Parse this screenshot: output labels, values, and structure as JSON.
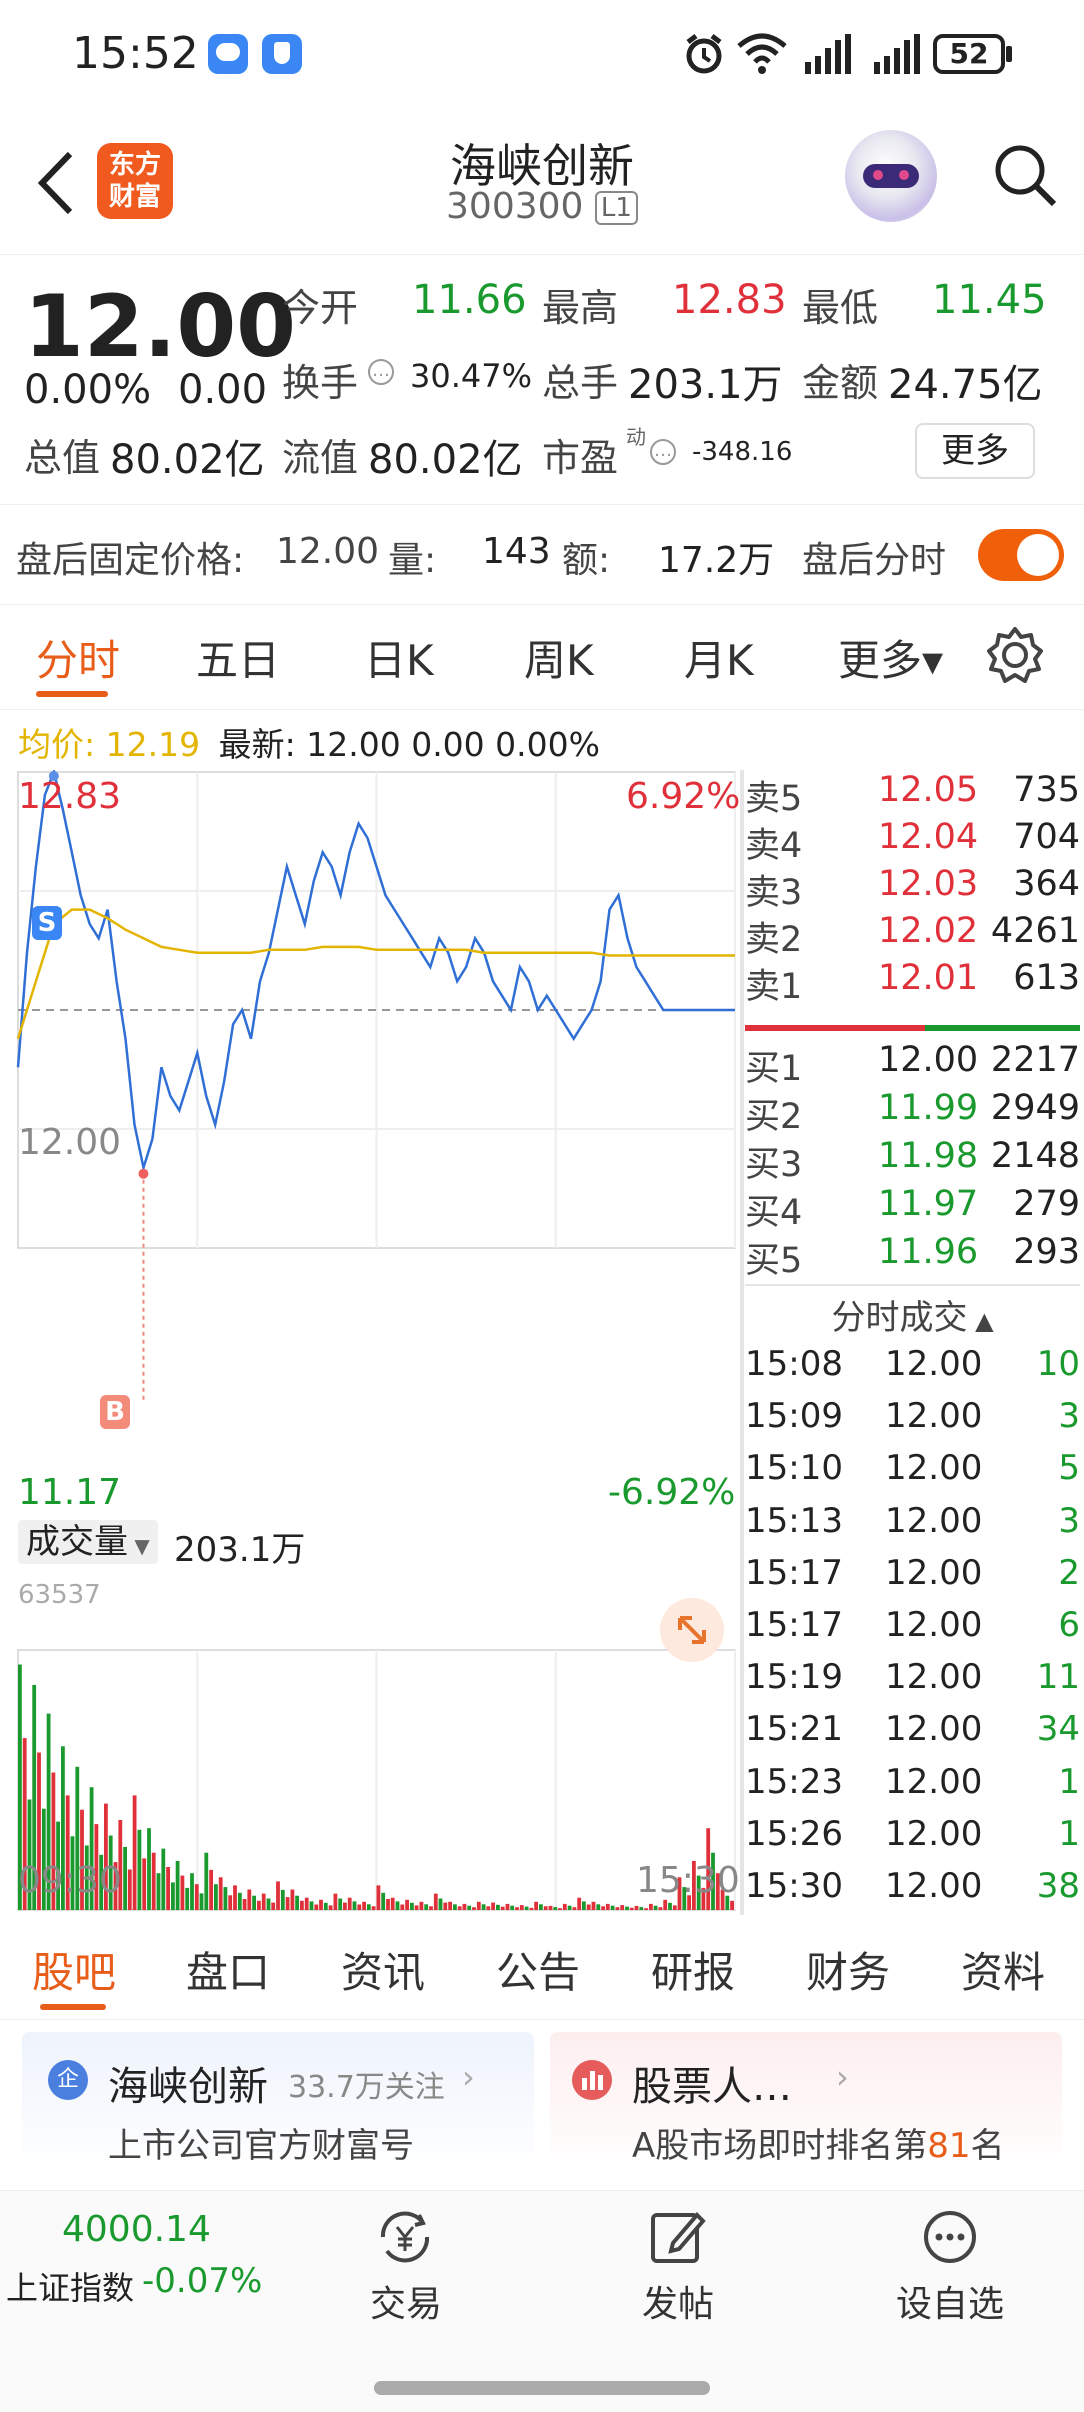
{
  "status": {
    "time": "15:52",
    "battery": "52"
  },
  "header": {
    "title": "海峡创新",
    "code": "300300",
    "level": "L1",
    "logo_line1": "东方",
    "logo_line2": "财富"
  },
  "quote": {
    "price": "12.00",
    "chg_pct": "0.00%",
    "chg": "0.00",
    "open_label": "今开",
    "open": "11.66",
    "high_label": "最高",
    "high": "12.83",
    "low_label": "最低",
    "low": "11.45",
    "turnover_label": "换手",
    "turnover": "30.47%",
    "vol_label": "总手",
    "vol": "203.1万",
    "amount_label": "金额",
    "amount": "24.75亿",
    "mcap_label": "总值",
    "mcap": "80.02亿",
    "float_label": "流值",
    "float": "80.02亿",
    "pe_label": "市盈",
    "pe_sup": "动",
    "pe": "-348.16",
    "more": "更多"
  },
  "afterhours": {
    "label": "盘后固定价格:",
    "price": "12.00",
    "vol_label": "量:",
    "vol": "143",
    "amt_label": "额:",
    "amt": "17.2万",
    "toggle_label": "盘后分时"
  },
  "chart_tabs": [
    "分时",
    "五日",
    "日K",
    "周K",
    "月K",
    "更多▾"
  ],
  "avg_line": {
    "avg_label": "均价:",
    "avg": "12.19",
    "latest_label": "最新:",
    "latest": "12.00 0.00 0.00%"
  },
  "chart_labels": {
    "high": "12.83",
    "high_pct": "6.92%",
    "mid": "12.00",
    "low": "11.17",
    "low_pct": "-6.92%",
    "marker_s": "S",
    "marker_b": "B"
  },
  "volume": {
    "label": "成交量",
    "total": "203.1万",
    "max": "63537",
    "t_start": "09:30",
    "t_end": "15:30"
  },
  "order_book": {
    "asks": [
      {
        "l": "卖5",
        "p": "12.05",
        "v": "735"
      },
      {
        "l": "卖4",
        "p": "12.04",
        "v": "704"
      },
      {
        "l": "卖3",
        "p": "12.03",
        "v": "364"
      },
      {
        "l": "卖2",
        "p": "12.02",
        "v": "4261"
      },
      {
        "l": "卖1",
        "p": "12.01",
        "v": "613"
      }
    ],
    "bids": [
      {
        "l": "买1",
        "p": "12.00",
        "v": "2217"
      },
      {
        "l": "买2",
        "p": "11.99",
        "v": "2949"
      },
      {
        "l": "买3",
        "p": "11.98",
        "v": "2148"
      },
      {
        "l": "买4",
        "p": "11.97",
        "v": "279"
      },
      {
        "l": "买5",
        "p": "11.96",
        "v": "293"
      }
    ]
  },
  "trades": {
    "title": "分时成交",
    "rows": [
      {
        "t": "15:08",
        "p": "12.00",
        "v": "10"
      },
      {
        "t": "15:09",
        "p": "12.00",
        "v": "3"
      },
      {
        "t": "15:10",
        "p": "12.00",
        "v": "5"
      },
      {
        "t": "15:13",
        "p": "12.00",
        "v": "3"
      },
      {
        "t": "15:17",
        "p": "12.00",
        "v": "2"
      },
      {
        "t": "15:17",
        "p": "12.00",
        "v": "6"
      },
      {
        "t": "15:19",
        "p": "12.00",
        "v": "11"
      },
      {
        "t": "15:21",
        "p": "12.00",
        "v": "34"
      },
      {
        "t": "15:23",
        "p": "12.00",
        "v": "1"
      },
      {
        "t": "15:26",
        "p": "12.00",
        "v": "1"
      },
      {
        "t": "15:30",
        "p": "12.00",
        "v": "38"
      }
    ]
  },
  "bottom_tabs": [
    "股吧",
    "盘口",
    "资讯",
    "公告",
    "研报",
    "财务",
    "资料"
  ],
  "cards": [
    {
      "icon": "企",
      "title": "海峡创新",
      "sub": "33.7万关注",
      "desc": "上市公司官方财富号"
    },
    {
      "title": "股票人…",
      "desc_a": "A股市场即时排名第",
      "rank": "81",
      "desc_b": "名"
    }
  ],
  "bottom_nav": {
    "index_value": "4000.14",
    "index_name": "上证指数",
    "index_chg": "-0.07%",
    "trade": "交易",
    "post": "发帖",
    "watch": "设自选"
  },
  "chart_data": {
    "type": "line",
    "y_range": [
      11.17,
      12.83
    ],
    "prev_close": 12.0,
    "price_series": [
      11.8,
      12.2,
      12.5,
      12.75,
      12.83,
      12.7,
      12.55,
      12.4,
      12.3,
      12.25,
      12.35,
      12.1,
      11.9,
      11.6,
      11.45,
      11.55,
      11.8,
      11.7,
      11.65,
      11.75,
      11.85,
      11.7,
      11.6,
      11.75,
      11.95,
      12.0,
      11.9,
      12.1,
      12.2,
      12.35,
      12.5,
      12.4,
      12.3,
      12.45,
      12.55,
      12.5,
      12.4,
      12.55,
      12.65,
      12.6,
      12.5,
      12.4,
      12.35,
      12.3,
      12.25,
      12.2,
      12.15,
      12.25,
      12.2,
      12.1,
      12.15,
      12.25,
      12.2,
      12.1,
      12.05,
      12.0,
      12.15,
      12.1,
      12.0,
      12.05,
      12.0,
      11.95,
      11.9,
      11.95,
      12.0,
      12.1,
      12.35,
      12.4,
      12.25,
      12.15,
      12.1,
      12.05,
      12.0,
      12.0,
      12.0,
      12.0,
      12.0,
      12.0,
      12.0,
      12.0,
      12.0
    ],
    "avg_series": [
      11.9,
      12.1,
      12.3,
      12.35,
      12.35,
      12.32,
      12.28,
      12.25,
      12.22,
      12.21,
      12.2,
      12.2,
      12.2,
      12.2,
      12.21,
      12.21,
      12.21,
      12.22,
      12.22,
      12.22,
      12.21,
      12.21,
      12.21,
      12.21,
      12.21,
      12.21,
      12.2,
      12.2,
      12.2,
      12.2,
      12.2,
      12.2,
      12.2,
      12.19,
      12.19,
      12.19,
      12.19,
      12.19,
      12.19,
      12.19,
      12.19
    ],
    "volume_series": [
      {
        "v": 60000,
        "c": "r"
      },
      {
        "v": 55000,
        "c": "g"
      },
      {
        "v": 48000,
        "c": "r"
      },
      {
        "v": 40000,
        "c": "g"
      },
      {
        "v": 35000,
        "c": "r"
      },
      {
        "v": 30000,
        "c": "g"
      },
      {
        "v": 26000,
        "c": "g"
      },
      {
        "v": 22000,
        "c": "r"
      },
      {
        "v": 28000,
        "c": "g"
      },
      {
        "v": 20000,
        "c": "g"
      },
      {
        "v": 15000,
        "c": "r"
      },
      {
        "v": 12000,
        "c": "g"
      },
      {
        "v": 9000,
        "c": "r"
      },
      {
        "v": 14000,
        "c": "g"
      },
      {
        "v": 8000,
        "c": "g"
      },
      {
        "v": 6000,
        "c": "r"
      },
      {
        "v": 5000,
        "c": "g"
      },
      {
        "v": 4000,
        "c": "r"
      },
      {
        "v": 7000,
        "c": "g"
      },
      {
        "v": 5000,
        "c": "r"
      },
      {
        "v": 3000,
        "c": "g"
      },
      {
        "v": 2500,
        "c": "r"
      },
      {
        "v": 4000,
        "c": "g"
      },
      {
        "v": 3000,
        "c": "r"
      },
      {
        "v": 2000,
        "c": "g"
      },
      {
        "v": 6000,
        "c": "r"
      },
      {
        "v": 3000,
        "c": "g"
      },
      {
        "v": 2500,
        "c": "r"
      },
      {
        "v": 2000,
        "c": "g"
      },
      {
        "v": 4000,
        "c": "r"
      },
      {
        "v": 2000,
        "c": "g"
      },
      {
        "v": 1500,
        "c": "r"
      },
      {
        "v": 2000,
        "c": "g"
      },
      {
        "v": 1800,
        "c": "r"
      },
      {
        "v": 1500,
        "c": "g"
      },
      {
        "v": 1200,
        "c": "r"
      },
      {
        "v": 2000,
        "c": "g"
      },
      {
        "v": 1000,
        "c": "r"
      },
      {
        "v": 1500,
        "c": "g"
      },
      {
        "v": 3000,
        "c": "r"
      },
      {
        "v": 2000,
        "c": "g"
      },
      {
        "v": 1500,
        "c": "r"
      },
      {
        "v": 1200,
        "c": "g"
      },
      {
        "v": 1000,
        "c": "r"
      },
      {
        "v": 1500,
        "c": "g"
      },
      {
        "v": 2500,
        "c": "r"
      },
      {
        "v": 8000,
        "c": "g"
      },
      {
        "v": 12000,
        "c": "r"
      },
      {
        "v": 20000,
        "c": "g"
      },
      {
        "v": 5000,
        "c": "r"
      }
    ]
  }
}
